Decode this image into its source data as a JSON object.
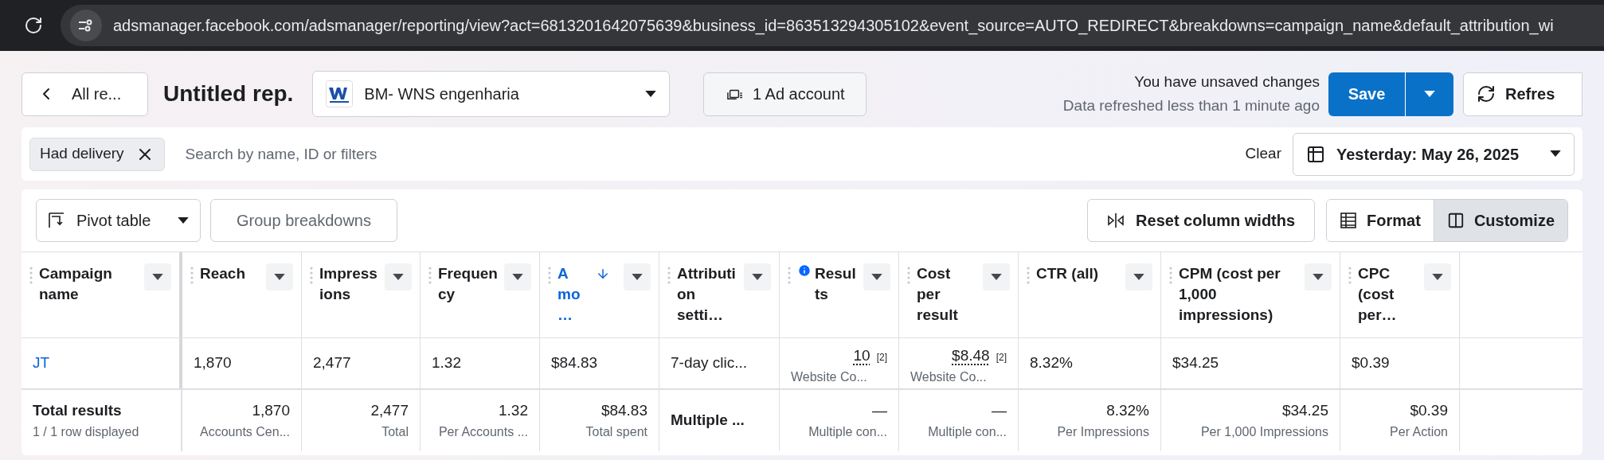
{
  "browser": {
    "url": "adsmanager.facebook.com/adsmanager/reporting/view?act=6813201642075639&business_id=863513294305102&event_source=AUTO_REDIRECT&breakdowns=campaign_name&default_attribution_wi"
  },
  "header": {
    "back": "All re...",
    "title": "Untitled rep.",
    "account": "BM- WNS engenharia",
    "ad_account": "1 Ad account",
    "status": "You have unsaved changes",
    "refreshed": "Data refreshed less than 1 minute ago",
    "save": "Save",
    "refresh": "Refres"
  },
  "filters": {
    "chips": [
      {
        "label": "Had delivery"
      }
    ],
    "placeholder": "Search by name, ID or filters",
    "clear": "Clear",
    "date": "Yesterday: May 26, 2025"
  },
  "toolbar": {
    "pivot": "Pivot table",
    "group": "Group breakdowns",
    "reset": "Reset column widths",
    "views": [
      {
        "label": "Format",
        "selected": false
      },
      {
        "label": "Customize",
        "selected": true
      }
    ]
  },
  "table": {
    "columns": [
      {
        "label": "Campaign name",
        "sorted": false,
        "info": false
      },
      {
        "label": "Reach",
        "sorted": false,
        "info": false
      },
      {
        "label": "Impressions",
        "sorted": false,
        "info": false
      },
      {
        "label": "Frequency",
        "sorted": false,
        "info": false
      },
      {
        "label": "Amo…",
        "sorted": true,
        "info": false
      },
      {
        "label": "Attribution setti…",
        "sorted": false,
        "info": false
      },
      {
        "label": "Results",
        "sorted": false,
        "info": true
      },
      {
        "label": "Cost per result",
        "sorted": false,
        "info": false
      },
      {
        "label": "CTR (all)",
        "sorted": false,
        "info": false
      },
      {
        "label": "CPM (cost per 1,000 impressions)",
        "sorted": false,
        "info": false
      },
      {
        "label": "CPC (cost per…",
        "sorted": false,
        "info": false
      }
    ],
    "rows": [
      {
        "cells": [
          {
            "kind": "link",
            "value": "JT"
          },
          {
            "kind": "plain",
            "value": "1,870"
          },
          {
            "kind": "plain",
            "value": "2,477"
          },
          {
            "kind": "plain",
            "value": "1.32"
          },
          {
            "kind": "plain",
            "value": "$84.83"
          },
          {
            "kind": "plain",
            "value": "7-day clic..."
          },
          {
            "kind": "metric",
            "value": "10",
            "note": "[2]",
            "sub": "Website Co..."
          },
          {
            "kind": "metric",
            "value": "$8.48",
            "note": "[2]",
            "sub": "Website Co..."
          },
          {
            "kind": "plain",
            "value": "8.32%"
          },
          {
            "kind": "plain",
            "value": "$34.25"
          },
          {
            "kind": "plain",
            "value": "$0.39"
          }
        ]
      }
    ],
    "total": [
      {
        "kind": "label",
        "value": "Total results",
        "sub": "1 / 1 row displayed"
      },
      {
        "kind": "number",
        "value": "1,870",
        "sub": "Accounts Cen..."
      },
      {
        "kind": "number",
        "value": "2,477",
        "sub": "Total"
      },
      {
        "kind": "number",
        "value": "1.32",
        "sub": "Per Accounts ..."
      },
      {
        "kind": "number",
        "value": "$84.83",
        "sub": "Total spent"
      },
      {
        "kind": "bold",
        "value": "Multiple ..."
      },
      {
        "kind": "number",
        "value": "—",
        "sub": "Multiple con..."
      },
      {
        "kind": "number",
        "value": "—",
        "sub": "Multiple con..."
      },
      {
        "kind": "number",
        "value": "8.32%",
        "sub": "Per Impressions"
      },
      {
        "kind": "number",
        "value": "$34.25",
        "sub": "Per 1,000 Impressions"
      },
      {
        "kind": "number",
        "value": "$0.39",
        "sub": "Per Action"
      }
    ]
  }
}
